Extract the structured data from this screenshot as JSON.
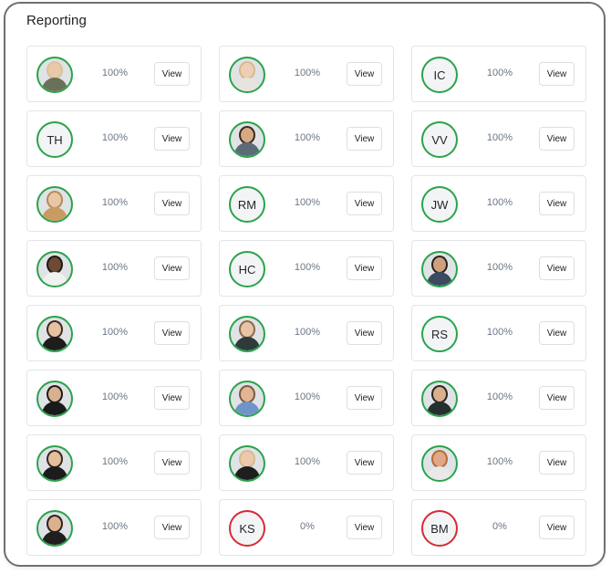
{
  "header": {
    "title": "Reporting"
  },
  "view_label": "View",
  "cards": [
    {
      "avatar": "photo",
      "initials": "",
      "percent": "100%",
      "ring": "green",
      "skin": "#e9c9a8",
      "hair": "#d8c39a",
      "shirt": "#6b7058"
    },
    {
      "avatar": "photo",
      "initials": "",
      "percent": "100%",
      "ring": "green",
      "skin": "#efcfb4",
      "hair": "#d7b98c",
      "shirt": "#e7e4df"
    },
    {
      "avatar": "initials",
      "initials": "IC",
      "percent": "100%",
      "ring": "green"
    },
    {
      "avatar": "initials",
      "initials": "TH",
      "percent": "100%",
      "ring": "green"
    },
    {
      "avatar": "photo",
      "initials": "",
      "percent": "100%",
      "ring": "green",
      "skin": "#d6a984",
      "hair": "#3b2a20",
      "shirt": "#5d6a78"
    },
    {
      "avatar": "initials",
      "initials": "VV",
      "percent": "100%",
      "ring": "green"
    },
    {
      "avatar": "photo",
      "initials": "",
      "percent": "100%",
      "ring": "green",
      "skin": "#e9c7a5",
      "hair": "#b58a5c",
      "shirt": "#c89b62"
    },
    {
      "avatar": "initials",
      "initials": "RM",
      "percent": "100%",
      "ring": "green"
    },
    {
      "avatar": "initials",
      "initials": "JW",
      "percent": "100%",
      "ring": "green"
    },
    {
      "avatar": "photo",
      "initials": "",
      "percent": "100%",
      "ring": "green",
      "skin": "#6e4a36",
      "hair": "#1e1814",
      "shirt": "#f1f1f1"
    },
    {
      "avatar": "initials",
      "initials": "HC",
      "percent": "100%",
      "ring": "green"
    },
    {
      "avatar": "photo",
      "initials": "",
      "percent": "100%",
      "ring": "green",
      "skin": "#cfa07e",
      "hair": "#2a211c",
      "shirt": "#3a4a60"
    },
    {
      "avatar": "photo",
      "initials": "",
      "percent": "100%",
      "ring": "green",
      "skin": "#e6c2a2",
      "hair": "#3a2a22",
      "shirt": "#1d1d1d"
    },
    {
      "avatar": "photo",
      "initials": "",
      "percent": "100%",
      "ring": "green",
      "skin": "#e7c4a6",
      "hair": "#8c6a48",
      "shirt": "#2f3b3b"
    },
    {
      "avatar": "initials",
      "initials": "RS",
      "percent": "100%",
      "ring": "green"
    },
    {
      "avatar": "photo",
      "initials": "",
      "percent": "100%",
      "ring": "green",
      "skin": "#d8b190",
      "hair": "#1f1a17",
      "shirt": "#1a1a1a"
    },
    {
      "avatar": "photo",
      "initials": "",
      "percent": "100%",
      "ring": "green",
      "skin": "#e2b594",
      "hair": "#7a5a3e",
      "shirt": "#6f94c7"
    },
    {
      "avatar": "photo",
      "initials": "",
      "percent": "100%",
      "ring": "green",
      "skin": "#d9b08c",
      "hair": "#2b2420",
      "shirt": "#24302e"
    },
    {
      "avatar": "photo",
      "initials": "",
      "percent": "100%",
      "ring": "green",
      "skin": "#e3bf9c",
      "hair": "#3a2820",
      "shirt": "#1c1c1c"
    },
    {
      "avatar": "photo",
      "initials": "",
      "percent": "100%",
      "ring": "green",
      "skin": "#ecc9ad",
      "hair": "#d6bb8c",
      "shirt": "#1e1e1e"
    },
    {
      "avatar": "photo",
      "initials": "",
      "percent": "100%",
      "ring": "green",
      "skin": "#e0a884",
      "hair": "#b86a3a",
      "shirt": "#e9e9e9"
    },
    {
      "avatar": "photo",
      "initials": "",
      "percent": "100%",
      "ring": "green",
      "skin": "#dcb08f",
      "hair": "#2b221c",
      "shirt": "#1f1f1f"
    },
    {
      "avatar": "initials",
      "initials": "KS",
      "percent": "0%",
      "ring": "red"
    },
    {
      "avatar": "initials",
      "initials": "BM",
      "percent": "0%",
      "ring": "red"
    }
  ]
}
